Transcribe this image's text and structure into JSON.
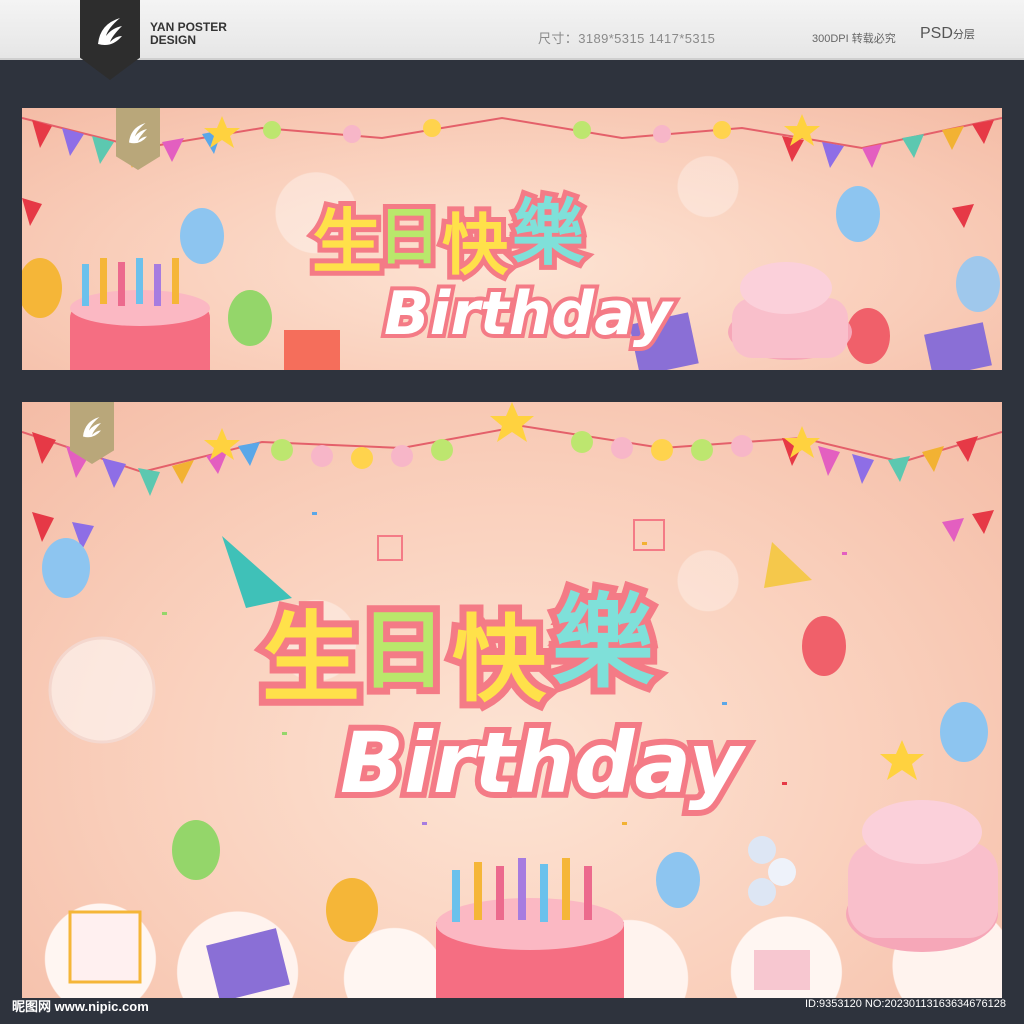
{
  "header": {
    "brand_line1": "YAN POSTER",
    "brand_line2": "DESIGN",
    "size_text": "尺寸：3189*5315  1417*5315",
    "dpi_text": "300DPI  转载必究",
    "psd_text": "PSD",
    "psd_suffix": "分层"
  },
  "poster": {
    "title_cn": [
      "生",
      "日",
      "快",
      "樂"
    ],
    "subtitle_en": "Birthday"
  },
  "footer": {
    "site": "昵图网 www.nipic.com",
    "id_text": "ID:9353120 NO:20230113163634676128"
  },
  "colors": {
    "title_yellow": "#ffe14a",
    "title_green": "#b9e86b",
    "title_teal": "#7fe0d9",
    "title_outline": "#f47b86"
  }
}
